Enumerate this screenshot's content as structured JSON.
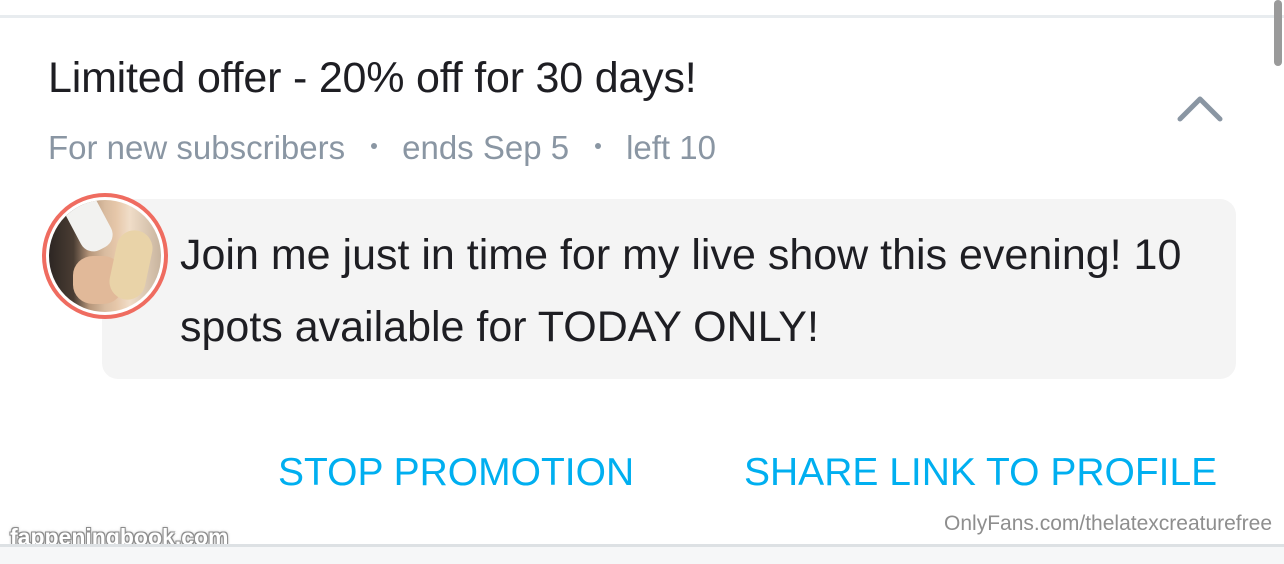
{
  "promo": {
    "title": "Limited offer - 20% off for 30 days!",
    "audience": "For new subscribers",
    "ends": "ends Sep 5",
    "left": "left 10",
    "message": "Join me just in time for my live show this evening! 10 spots available for TODAY ONLY!",
    "collapse_icon": "chevron-up-icon"
  },
  "actions": {
    "stop_label": "STOP PROMOTION",
    "share_label": "SHARE LINK TO PROFILE"
  },
  "watermarks": {
    "profile_url": "OnlyFans.com/thelatexcreaturefree",
    "site": "fappeningbook.com"
  },
  "colors": {
    "accent": "#00aff0",
    "avatar_ring": "#ef6c60",
    "muted_text": "#8a96a3",
    "bubble_bg": "#f4f4f4"
  }
}
